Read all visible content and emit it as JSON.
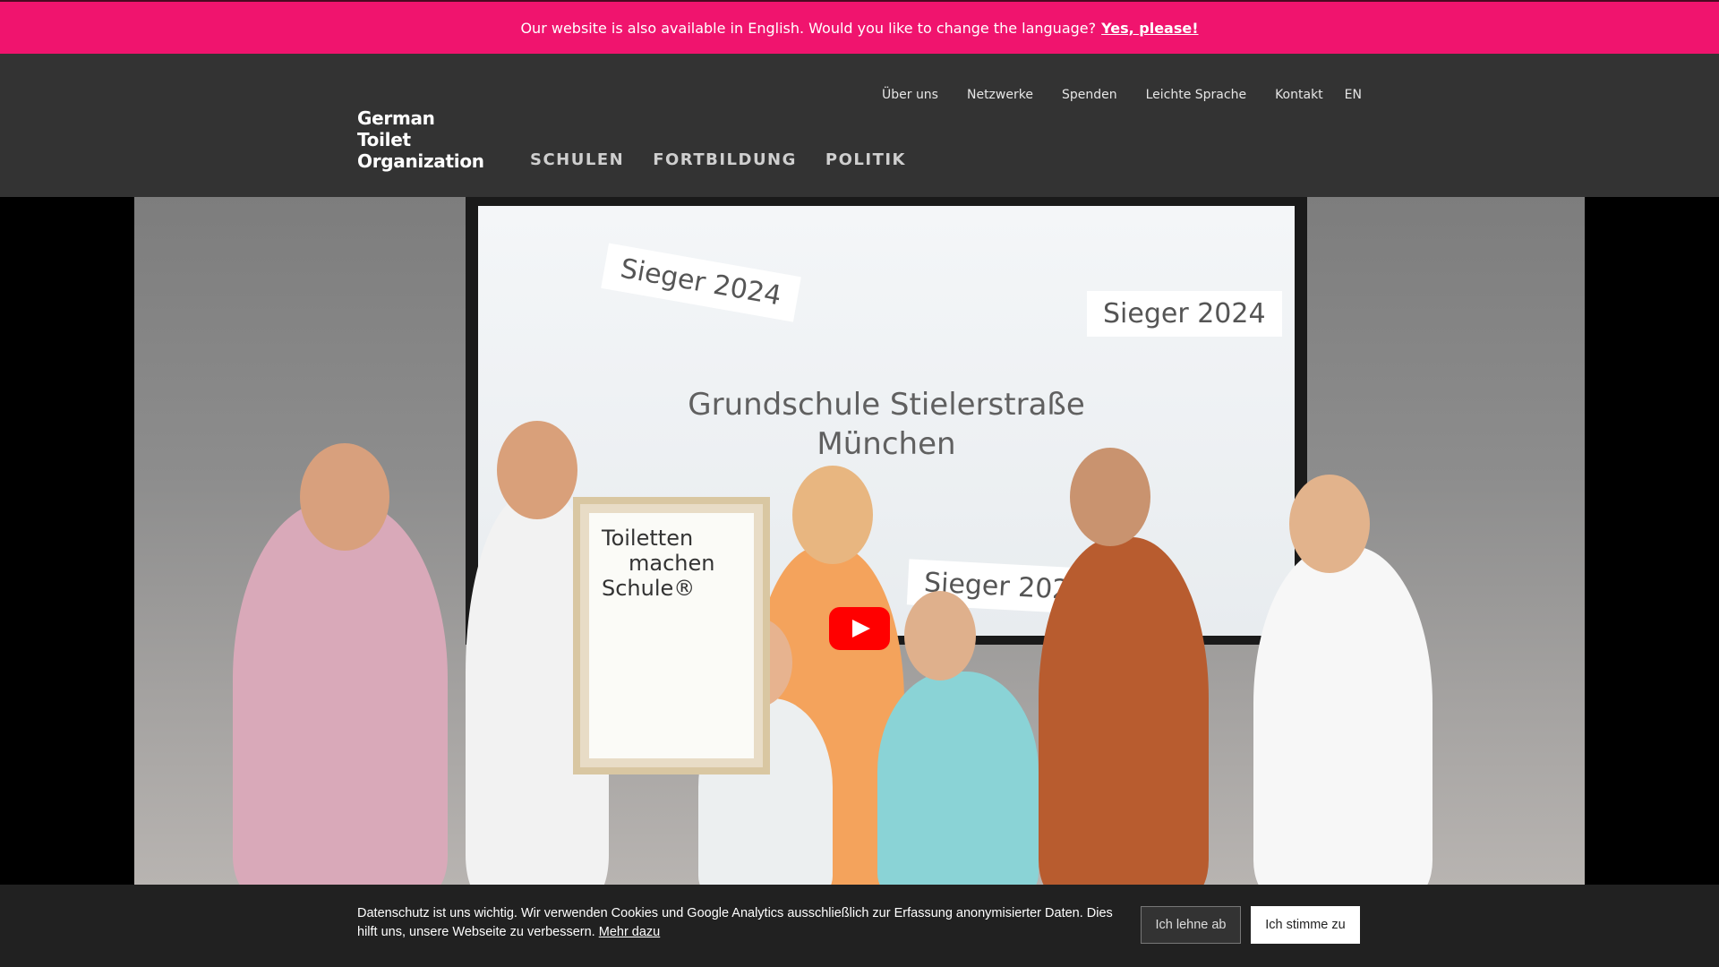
{
  "language_banner": {
    "message": "Our website is also available in English. Would you like to change the language?",
    "action_label": "Yes, please!"
  },
  "logo": {
    "line1": "German",
    "line2": "Toilet",
    "line3": "Organization"
  },
  "top_nav": {
    "items": [
      "Über uns",
      "Netzwerke",
      "Spenden",
      "Leichte Sprache",
      "Kontakt"
    ],
    "language": "EN"
  },
  "main_nav": {
    "items": [
      "SCHULEN",
      "FORTBILDUNG",
      "POLITIK"
    ]
  },
  "video": {
    "screen_tags": [
      "Sieger 2024",
      "Sieger 2024",
      "Sieger 2024"
    ],
    "school_line1": "Grundschule Stielerstraße",
    "school_line2": "München",
    "poster_line1": "Toiletten",
    "poster_line2": "machen",
    "poster_line3": "Schule®"
  },
  "cookie_banner": {
    "text": "Datenschutz ist uns wichtig. Wir verwenden Cookies und Google Analytics ausschließlich zur Erfassung anonymisierter Daten. Dies hilft uns, unsere Webseite zu verbessern.",
    "link_label": "Mehr dazu",
    "decline_label": "Ich lehne ab",
    "accept_label": "Ich stimme zu"
  },
  "colors": {
    "banner_bg": "#f0146e",
    "header_bg": "#333333",
    "cookie_bg": "#212121",
    "play_button": "#ff0000"
  }
}
